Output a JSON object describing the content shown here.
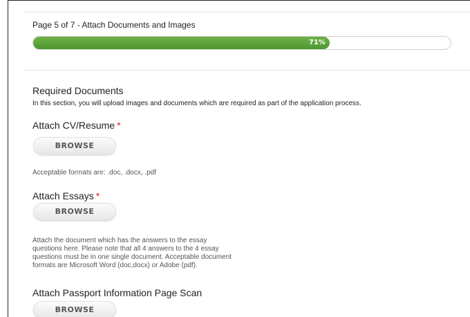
{
  "progress": {
    "page_label": "Page 5 of 7 - Attach Documents and Images",
    "percent": 71,
    "percent_label": "71%",
    "fill_color": "#5aa23a"
  },
  "section": {
    "title": "Required Documents",
    "description": "In this section, you will upload images and documents which are required as part of the application process."
  },
  "fields": {
    "cv": {
      "label": "Attach CV/Resume",
      "required_mark": "*",
      "button_label": "BROWSE",
      "help": "Acceptable formats are: .doc, .docx, .pdf"
    },
    "essays": {
      "label": "Attach Essays",
      "required_mark": "*",
      "button_label": "BROWSE",
      "help_lines": [
        "Attach the document which has the answers to the essay",
        "questions here. Please note that all 4 answers to the 4 essay",
        "questions must be in one single document. Acceptable document",
        "formats are Microsoft Word (doc,docx) or Adobe (pdf)."
      ]
    },
    "passport": {
      "label": "Attach Passport Information Page Scan",
      "button_label": "BROWSE"
    }
  },
  "colors": {
    "required": "#d92020",
    "progress_green": "#5aa23a"
  }
}
